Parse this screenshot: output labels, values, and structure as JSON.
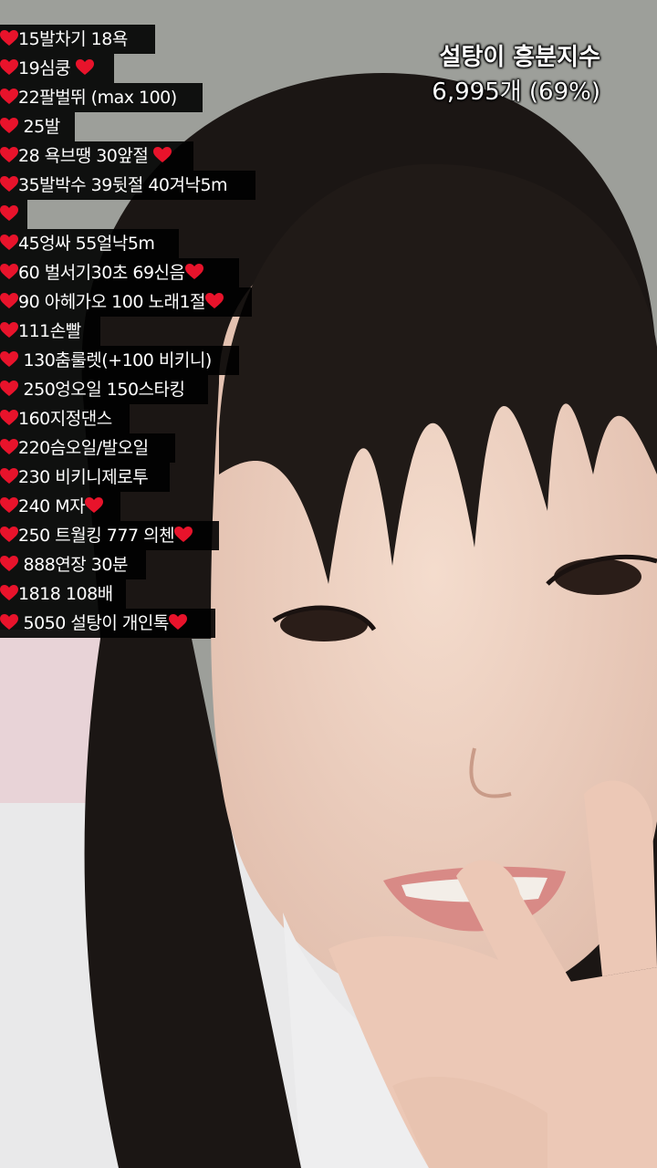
{
  "colors": {
    "heart": "#e8132b",
    "overlay": "#000000",
    "text": "#ffffff"
  },
  "icons": {
    "heart": "heart-icon"
  },
  "counter": {
    "title": "설탕이 흥분지수",
    "value": "6,995개 (69%)"
  },
  "menu": [
    {
      "pre": "",
      "text": "15발차기 18욕",
      "post": ""
    },
    {
      "pre": "",
      "text": "19심쿵 ",
      "post": "heart"
    },
    {
      "pre": "",
      "text": "22팔벌뛰 (max 100)",
      "post": ""
    },
    {
      "pre": "",
      "text": " 25발",
      "post": ""
    },
    {
      "pre": "",
      "text": "28 욕브땡 30앞절 ",
      "post": "heart"
    },
    {
      "pre": "",
      "text": "35발박수 39뒷절 40겨낙5m",
      "post": ""
    },
    {
      "pre": "",
      "text": "",
      "post": ""
    },
    {
      "pre": "",
      "text": "45엉싸 55얼낙5m",
      "post": ""
    },
    {
      "pre": "",
      "text": "60 벌서기30초  69신음",
      "post": "heart"
    },
    {
      "pre": "",
      "text": "90 아헤가오 100 노래1절",
      "post": "heart"
    },
    {
      "pre": "",
      "text": "111손빨",
      "post": ""
    },
    {
      "pre": "",
      "text": " 130춤룰렛(+100 비키니)",
      "post": ""
    },
    {
      "pre": "",
      "text": " 250엉오일 150스타킹",
      "post": ""
    },
    {
      "pre": "",
      "text": "160지정댄스",
      "post": ""
    },
    {
      "pre": "",
      "text": "220슴오일/발오일",
      "post": ""
    },
    {
      "pre": "",
      "text": "230 비키니제로투",
      "post": ""
    },
    {
      "pre": "",
      "text": "240 M자",
      "post": "heart"
    },
    {
      "pre": "",
      "text": "250 트월킹 777 의첸",
      "post": "heart"
    },
    {
      "pre": "",
      "text": " 888연장 30분",
      "post": ""
    },
    {
      "pre": "",
      "text": "1818 108배",
      "post": ""
    },
    {
      "pre": "",
      "text": " 5050 설탕이 개인톡",
      "post": "heart"
    }
  ]
}
